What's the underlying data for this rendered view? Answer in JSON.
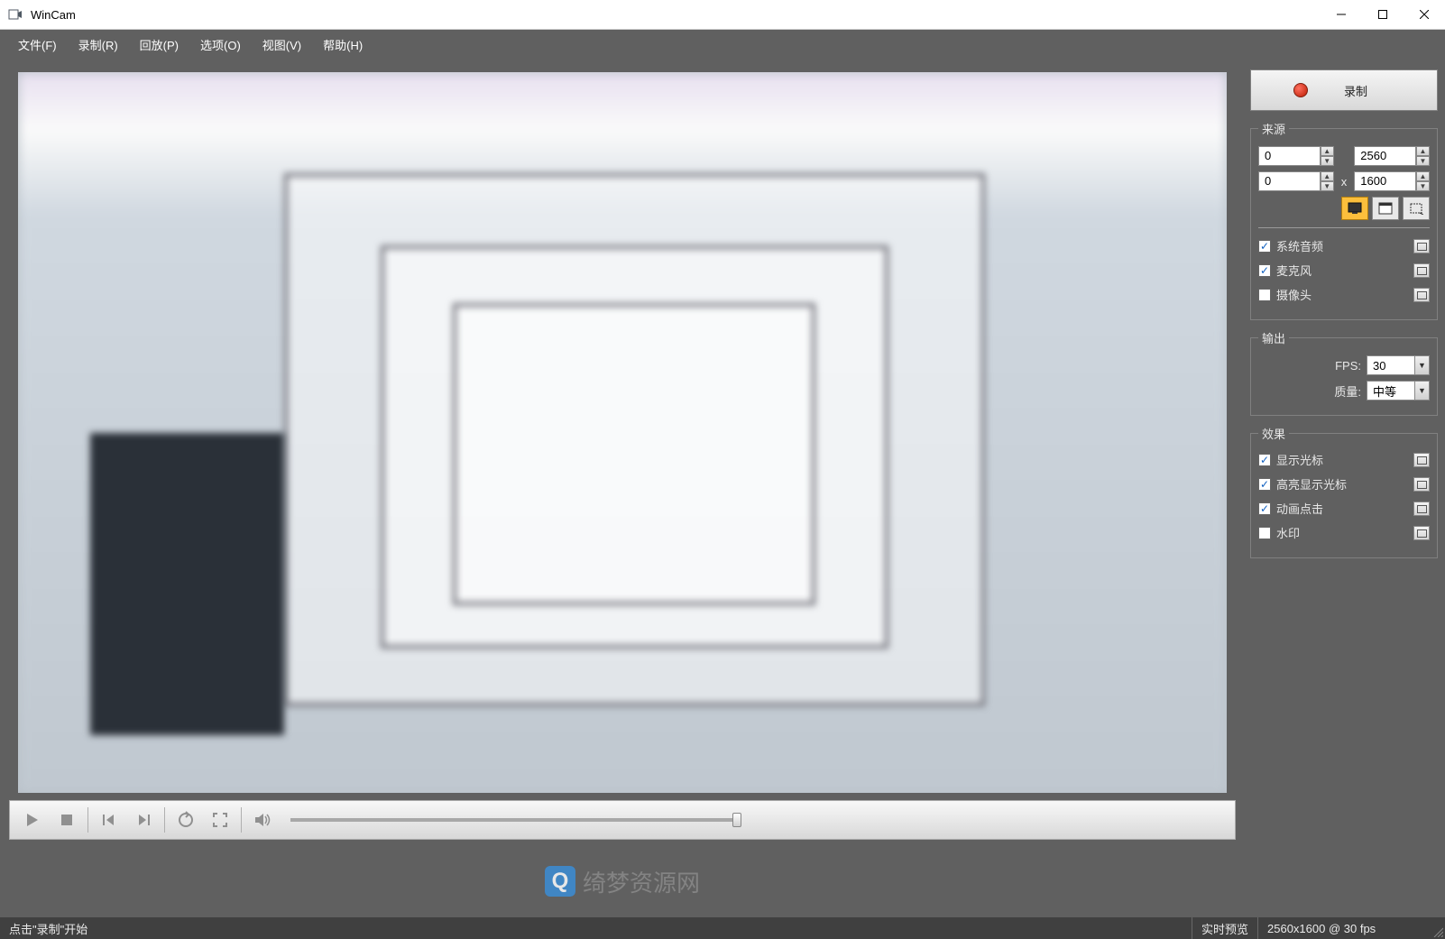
{
  "titlebar": {
    "title": "WinCam"
  },
  "menu": {
    "file": "文件(F)",
    "record": "录制(R)",
    "playback": "回放(P)",
    "options": "选项(O)",
    "view": "视图(V)",
    "help": "帮助(H)"
  },
  "record_button_label": "录制",
  "panel": {
    "source": {
      "legend": "来源",
      "x": "0",
      "y": "0",
      "w": "2560",
      "h": "1600",
      "sep": "x",
      "audio_system": "系统音频",
      "audio_mic": "麦克风",
      "camera": "摄像头"
    },
    "output": {
      "legend": "输出",
      "fps_label": "FPS:",
      "fps_value": "30",
      "quality_label": "质量:",
      "quality_value": "中等"
    },
    "effects": {
      "legend": "效果",
      "show_cursor": "显示光标",
      "highlight_cursor": "高亮显示光标",
      "animate_clicks": "动画点击",
      "watermark": "水印"
    }
  },
  "status": {
    "hint": "点击\"录制\"开始",
    "preview": "实时预览",
    "res_fps": "2560x1600 @ 30 fps"
  },
  "watermark_text": "绮梦资源网"
}
